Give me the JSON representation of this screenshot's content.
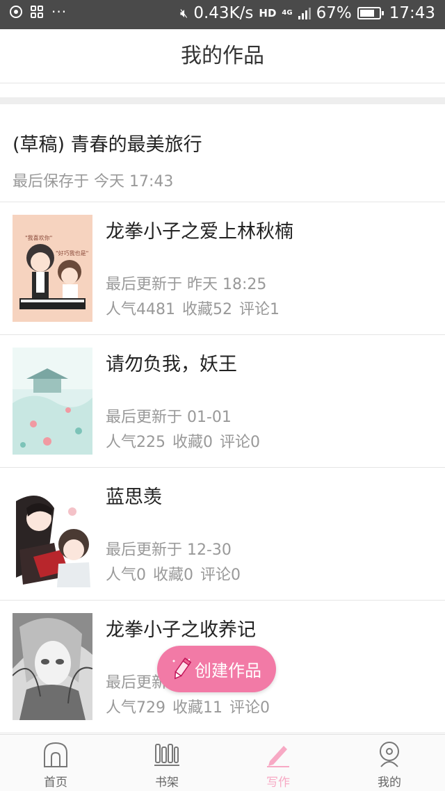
{
  "status_bar": {
    "speed": "0.43K/s",
    "hd": "HD",
    "network": "4G",
    "battery": "67%",
    "time": "17:43"
  },
  "header": {
    "title": "我的作品"
  },
  "draft": {
    "title": "(草稿) 青春的最美旅行",
    "saved": "最后保存于 今天 17:43"
  },
  "works": [
    {
      "title": "龙拳小子之爱上林秋楠",
      "updated": "最后更新于 昨天 18:25",
      "popularity": "人气4481",
      "favorites": "收藏52",
      "comments": "评论1"
    },
    {
      "title": "请勿负我，妖王",
      "updated": "最后更新于 01-01",
      "popularity": "人气225",
      "favorites": "收藏0",
      "comments": "评论0"
    },
    {
      "title": "蓝思羡",
      "updated": "最后更新于 12-30",
      "popularity": "人气0",
      "favorites": "收藏0",
      "comments": "评论0"
    },
    {
      "title": "龙拳小子之收养记",
      "updated": "最后更新于",
      "popularity": "人气729",
      "favorites": "收藏11",
      "comments": "评论0"
    }
  ],
  "fab": {
    "label": "创建作品",
    "icon": "pencil-icon"
  },
  "bottom_nav": [
    {
      "label": "首页",
      "icon": "home-icon"
    },
    {
      "label": "书架",
      "icon": "bookshelf-icon"
    },
    {
      "label": "写作",
      "icon": "pen-icon",
      "active": true
    },
    {
      "label": "我的",
      "icon": "profile-icon"
    }
  ],
  "colors": {
    "accent": "#f27aa6",
    "active_tab": "#f7a9c4",
    "status_bar": "#4a4a4a",
    "muted_text": "#999999"
  }
}
